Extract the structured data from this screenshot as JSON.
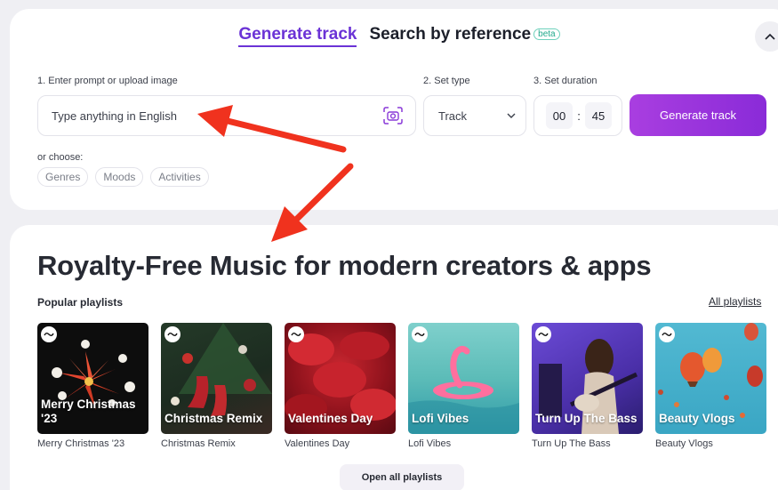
{
  "tabs": [
    {
      "label": "Generate track",
      "active": true
    },
    {
      "label": "Search by reference",
      "badge": "beta",
      "active": false
    }
  ],
  "form": {
    "prompt_label": "1. Enter prompt or upload image",
    "prompt_placeholder": "Type anything in English",
    "type_label": "2. Set type",
    "type_value": "Track",
    "duration_label": "3. Set duration",
    "duration_minutes": "00",
    "duration_separator": ":",
    "duration_seconds": "45",
    "generate_label": "Generate track",
    "or_choose": "or choose:",
    "chips": [
      "Genres",
      "Moods",
      "Activities"
    ]
  },
  "main": {
    "headline": "Royalty-Free Music for modern creators & apps",
    "popular_label": "Popular playlists",
    "all_playlists_label": "All playlists",
    "open_all_label": "Open all playlists",
    "playlists": [
      {
        "title": "Merry Christmas '23",
        "caption": "Merry Christmas '23"
      },
      {
        "title": "Christmas Remix",
        "caption": "Christmas Remix"
      },
      {
        "title": "Valentines Day",
        "caption": "Valentines Day"
      },
      {
        "title": "Lofi Vibes",
        "caption": "Lofi Vibes"
      },
      {
        "title": "Turn Up The Bass",
        "caption": "Turn Up The Bass"
      },
      {
        "title": "Beauty Vlogs",
        "caption": "Beauty Vlogs"
      }
    ]
  },
  "colors": {
    "accent": "#6b33d6",
    "button_gradient_start": "#a93ee0",
    "button_gradient_end": "#8a2bd8",
    "annotation_arrow": "#f0321e"
  },
  "icons": [
    "chevron-up-icon",
    "camera-icon",
    "chevron-down-icon",
    "wave-icon"
  ]
}
